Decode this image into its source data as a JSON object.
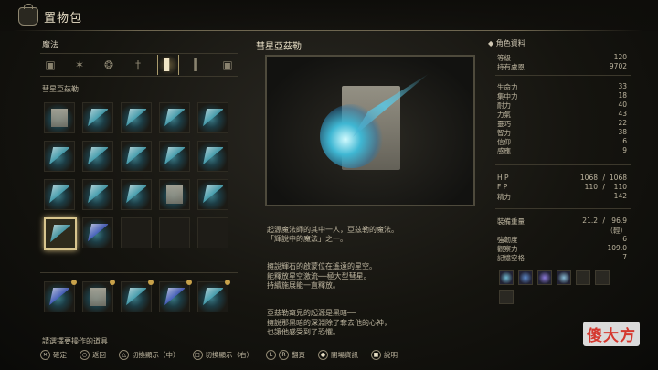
{
  "header": {
    "title": "置物包"
  },
  "left": {
    "category": "魔法",
    "tabs": [
      "▣",
      "✶",
      "❂",
      "†",
      "▋",
      "▍",
      "▣"
    ],
    "selected_name": "彗星亞茲勒"
  },
  "center": {
    "spell_title": "彗星亞茲勒",
    "desc_p1": "起源魔法師的其中一人，亞茲勒的魔法。\n「輝說中的魔法」之一。",
    "desc_p2": "擁說輝石的啟蒙位在遙遠的星空。\n能釋放星空激流──極大型彗星。\n持續施展能一直釋放。",
    "desc_p3": "亞茲勒窺見的起源是黑暗──\n擁說那黑暗的深淵除了奪去他的心神，\n也讓他感受到了恐懼。"
  },
  "right": {
    "title": "角色資料",
    "level_label": "等級",
    "level": "120",
    "runes_label": "持有盧恩",
    "runes": "9702",
    "attrs": [
      {
        "label": "生命力",
        "value": "33"
      },
      {
        "label": "集中力",
        "value": "18"
      },
      {
        "label": "耐力",
        "value": "40"
      },
      {
        "label": "力氣",
        "value": "43"
      },
      {
        "label": "靈巧",
        "value": "22"
      },
      {
        "label": "智力",
        "value": "38"
      },
      {
        "label": "信仰",
        "value": "6"
      },
      {
        "label": "感應",
        "value": "9"
      }
    ],
    "hp_label": "H P",
    "hp_cur": "1068",
    "hp_max": "1068",
    "fp_label": "F P",
    "fp_cur": "110",
    "fp_max": "110",
    "stam_label": "精力",
    "stam": "142",
    "equip_label": "裝備重量",
    "equip_cur": "21.2",
    "equip_max": "96.9",
    "equip_class": "（輕）",
    "poise_label": "強韌度",
    "poise": "6",
    "discovery_label": "觀察力",
    "discovery": "109.0",
    "slots_label": "記憶空格",
    "slots": "7"
  },
  "footer": {
    "help": "請選擇要操作的道具",
    "confirm": "確定",
    "back": "返回",
    "sw_mid": "切換顯示（中）",
    "sw_right": "切換顯示（右）",
    "page": "翻頁",
    "info": "開場資訊",
    "explain": "說明"
  },
  "watermark": "傻大方"
}
